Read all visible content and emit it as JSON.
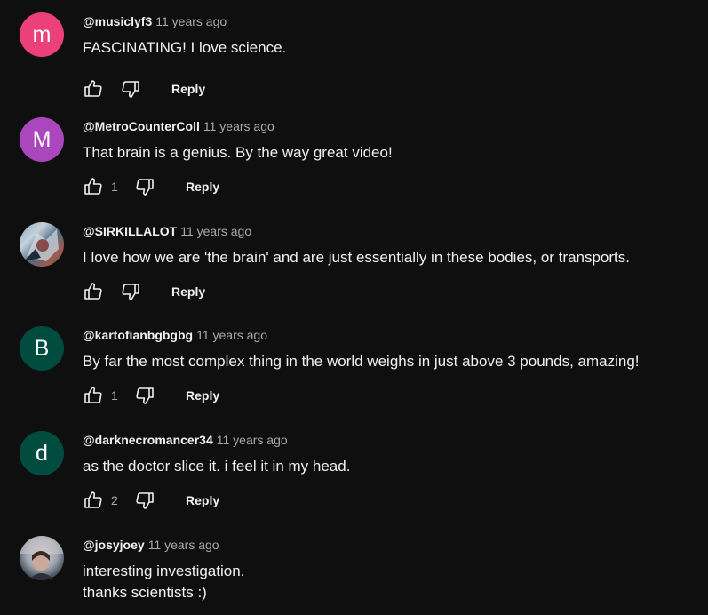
{
  "comments": [
    {
      "author": "@musiclyf3",
      "time": "11 years ago",
      "text": "FASCINATING! I love science.",
      "avatar_letter": "m",
      "avatar_color": "#ec407a",
      "likes": "",
      "reply": "Reply"
    },
    {
      "author": "@MetroCounterColl",
      "time": "11 years ago",
      "text": "That brain is a genius. By the way great video!",
      "avatar_letter": "M",
      "avatar_color": "#ab47bc",
      "likes": "1",
      "reply": "Reply"
    },
    {
      "author": "@SIRKILLALOT",
      "time": "11 years ago",
      "text": "I love how we are 'the brain' and are just essentially in these bodies, or transports.",
      "avatar_letter": "",
      "avatar_color": "",
      "likes": "",
      "reply": "Reply"
    },
    {
      "author": "@kartofianbgbgbg",
      "time": "11 years ago",
      "text": "By far the most complex thing in the world weighs in just above 3 pounds, amazing!",
      "avatar_letter": "B",
      "avatar_color": "#004d40",
      "likes": "1",
      "reply": "Reply"
    },
    {
      "author": "@darknecromancer34",
      "time": "11 years ago",
      "text": "as the doctor slice it. i feel it in my head.",
      "avatar_letter": "d",
      "avatar_color": "#004d40",
      "likes": "2",
      "reply": "Reply"
    },
    {
      "author": "@josyjoey",
      "time": "11 years ago",
      "text": "interesting investigation.\nthanks scientists :)",
      "avatar_letter": "",
      "avatar_color": "",
      "likes": "",
      "reply": ""
    }
  ]
}
